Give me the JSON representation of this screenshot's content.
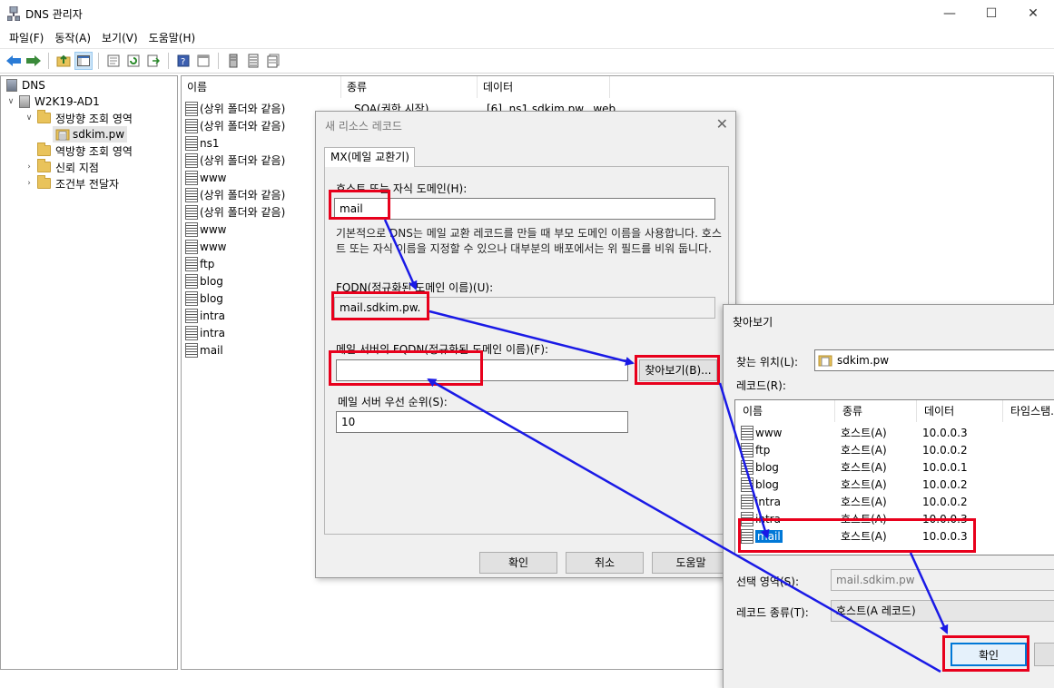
{
  "window": {
    "title": "DNS 관리자",
    "minimize": "—",
    "maximize": "☐",
    "close": "✕"
  },
  "menu": [
    "파일(F)",
    "동작(A)",
    "보기(V)",
    "도움말(H)"
  ],
  "tree": {
    "root": "DNS",
    "server": "W2K19-AD1",
    "forward_zone": "정방향 조회 영역",
    "zone": "sdkim.pw",
    "reverse_zone": "역방향 조회 영역",
    "trust_points": "신뢰 지점",
    "conditional_forwarders": "조건부 전달자"
  },
  "list": {
    "columns": [
      "이름",
      "종류",
      "데이터"
    ],
    "rows": [
      {
        "name": "(상위 폴더와 같음)",
        "type": "SOA(권한 시작)",
        "data": "[6], ns1.sdkim.pw., web."
      },
      {
        "name": "(상위 폴더와 같음)",
        "type": "",
        "data": ""
      },
      {
        "name": "ns1",
        "type": "",
        "data": ""
      },
      {
        "name": "(상위 폴더와 같음)",
        "type": "",
        "data": ""
      },
      {
        "name": "www",
        "type": "",
        "data": ""
      },
      {
        "name": "(상위 폴더와 같음)",
        "type": "",
        "data": ""
      },
      {
        "name": "(상위 폴더와 같음)",
        "type": "",
        "data": ""
      },
      {
        "name": "www",
        "type": "",
        "data": ""
      },
      {
        "name": "www",
        "type": "",
        "data": ""
      },
      {
        "name": "ftp",
        "type": "",
        "data": ""
      },
      {
        "name": "blog",
        "type": "",
        "data": ""
      },
      {
        "name": "blog",
        "type": "",
        "data": ""
      },
      {
        "name": "intra",
        "type": "",
        "data": ""
      },
      {
        "name": "intra",
        "type": "",
        "data": ""
      },
      {
        "name": "mail",
        "type": "",
        "data": ""
      }
    ]
  },
  "new_record_dialog": {
    "title": "새 리소스 레코드",
    "tab": "MX(메일 교환기)",
    "host_label": "호스트 또는 자식 도메인(H):",
    "host_value": "mail",
    "description": "기본적으로 DNS는 메일 교환 레코드를 만들 때 부모 도메인 이름을 사용합니다. 호스트 또는 자식 이름을 지정할 수 있으나 대부분의 배포에서는 위 필드를 비워 둡니다.",
    "fqdn_label": "FQDN(정규화된 도메인 이름)(U):",
    "fqdn_value": "mail.sdkim.pw.",
    "mail_server_label": "메일 서버의 FQDN(정규화된 도메인 이름)(F):",
    "mail_server_value": "",
    "browse_button": "찾아보기(B)...",
    "priority_label": "메일 서버 우선 순위(S):",
    "priority_value": "10",
    "ok": "확인",
    "cancel": "취소",
    "help": "도움말"
  },
  "browse_dialog": {
    "title": "찾아보기",
    "look_in_label": "찾는 위치(L):",
    "look_in_value": "sdkim.pw",
    "records_label": "레코드(R):",
    "columns": [
      "이름",
      "종류",
      "데이터",
      "타임스탬..."
    ],
    "rows": [
      {
        "name": "www",
        "type": "호스트(A)",
        "data": "10.0.0.3"
      },
      {
        "name": "ftp",
        "type": "호스트(A)",
        "data": "10.0.0.2"
      },
      {
        "name": "blog",
        "type": "호스트(A)",
        "data": "10.0.0.1"
      },
      {
        "name": "blog",
        "type": "호스트(A)",
        "data": "10.0.0.2"
      },
      {
        "name": "intra",
        "type": "호스트(A)",
        "data": "10.0.0.2"
      },
      {
        "name": "intra",
        "type": "호스트(A)",
        "data": "10.0.0.3"
      },
      {
        "name": "mail",
        "type": "호스트(A)",
        "data": "10.0.0.3"
      }
    ],
    "selection_label": "선택 영역(S):",
    "selection_value": "mail.sdkim.pw",
    "record_type_label": "레코드 종류(T):",
    "record_type_value": "호스트(A 레코드)",
    "ok": "확인"
  },
  "colors": {
    "highlight_box": "#e8001c",
    "arrow": "#1a1ae6",
    "selection": "#0078d7"
  }
}
